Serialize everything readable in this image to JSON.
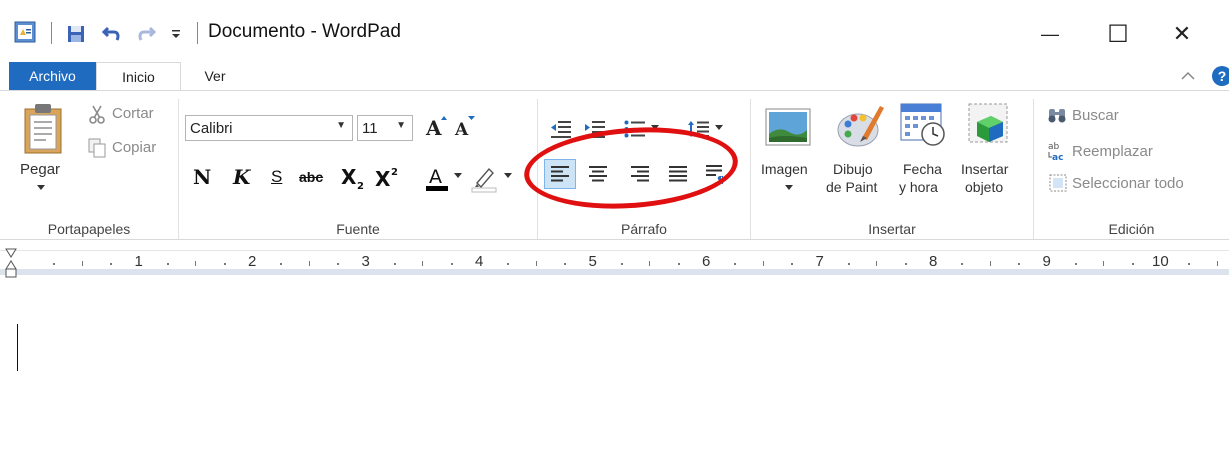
{
  "window": {
    "title": "Documento - WordPad",
    "minimize_glyph": "—",
    "maximize_glyph": "☐",
    "close_glyph": "✕"
  },
  "tabs": {
    "file": "Archivo",
    "home": "Inicio",
    "view": "Ver"
  },
  "clipboard": {
    "paste": "Pegar",
    "cut": "Cortar",
    "copy": "Copiar",
    "label": "Portapapeles"
  },
  "font": {
    "family": "Calibri",
    "size": "11",
    "bold": "N",
    "italic": "K",
    "underline": "S",
    "strikethrough": "abc",
    "label": "Fuente"
  },
  "paragraph": {
    "label": "Párrafo"
  },
  "insert": {
    "image_line1": "Imagen",
    "paint_line1": "Dibujo",
    "paint_line2": "de Paint",
    "datetime_line1": "Fecha",
    "datetime_line2": "y hora",
    "object_line1": "Insertar",
    "object_line2": "objeto",
    "label": "Insertar"
  },
  "editing": {
    "find": "Buscar",
    "replace": "Reemplazar",
    "select_all": "Seleccionar todo",
    "label": "Edición"
  },
  "ruler": {
    "numbers": [
      "1",
      "2",
      "3",
      "4",
      "5",
      "6",
      "7",
      "8",
      "9",
      "10"
    ]
  },
  "help_glyph": "?",
  "colors": {
    "accent": "#1e6bbf",
    "highlight": "#e01010"
  }
}
